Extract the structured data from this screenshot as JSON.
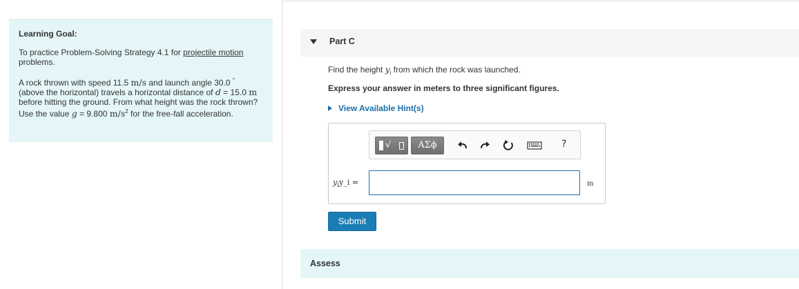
{
  "learning_goal": {
    "title": "Learning Goal:",
    "goal_prefix": "To practice Problem-Solving Strategy 4.1 for ",
    "goal_link": "projectile motion",
    "goal_suffix": "problems.",
    "problem": {
      "p1": "A rock thrown with speed 11.5 ",
      "speed_unit": "m/s",
      "p2": " and launch angle 30.0 ",
      "degree": "°",
      "p3": "(above the horizontal) travels a horizontal distance of ",
      "d_var": "d",
      "p4": " = 15.0 ",
      "dist_unit": "m",
      "p5": " before hitting the ground. From what height was the rock thrown? Use the value ",
      "g_var": "g",
      "p6": " = 9.800 ",
      "g_unit": "m/s",
      "g_exp": "2",
      "p7": " for the free-fall acceleration."
    }
  },
  "part": {
    "label": "Part C",
    "question_prefix": "Find the height ",
    "question_var": "y",
    "question_sub": "i",
    "question_suffix": " from which the rock was launched.",
    "instruction": "Express your answer in meters to three significant figures.",
    "hint_label": "View Available Hint(s)"
  },
  "answer": {
    "toolbar": {
      "greek_label": "ΑΣϕ",
      "radical_label": "√",
      "help_label": "?"
    },
    "variable_label_var": "y",
    "variable_label_sub": "i",
    "variable_label_text": "y_i =",
    "input_value": "",
    "unit": "m"
  },
  "submit_label": "Submit",
  "assess_label": "Assess"
}
